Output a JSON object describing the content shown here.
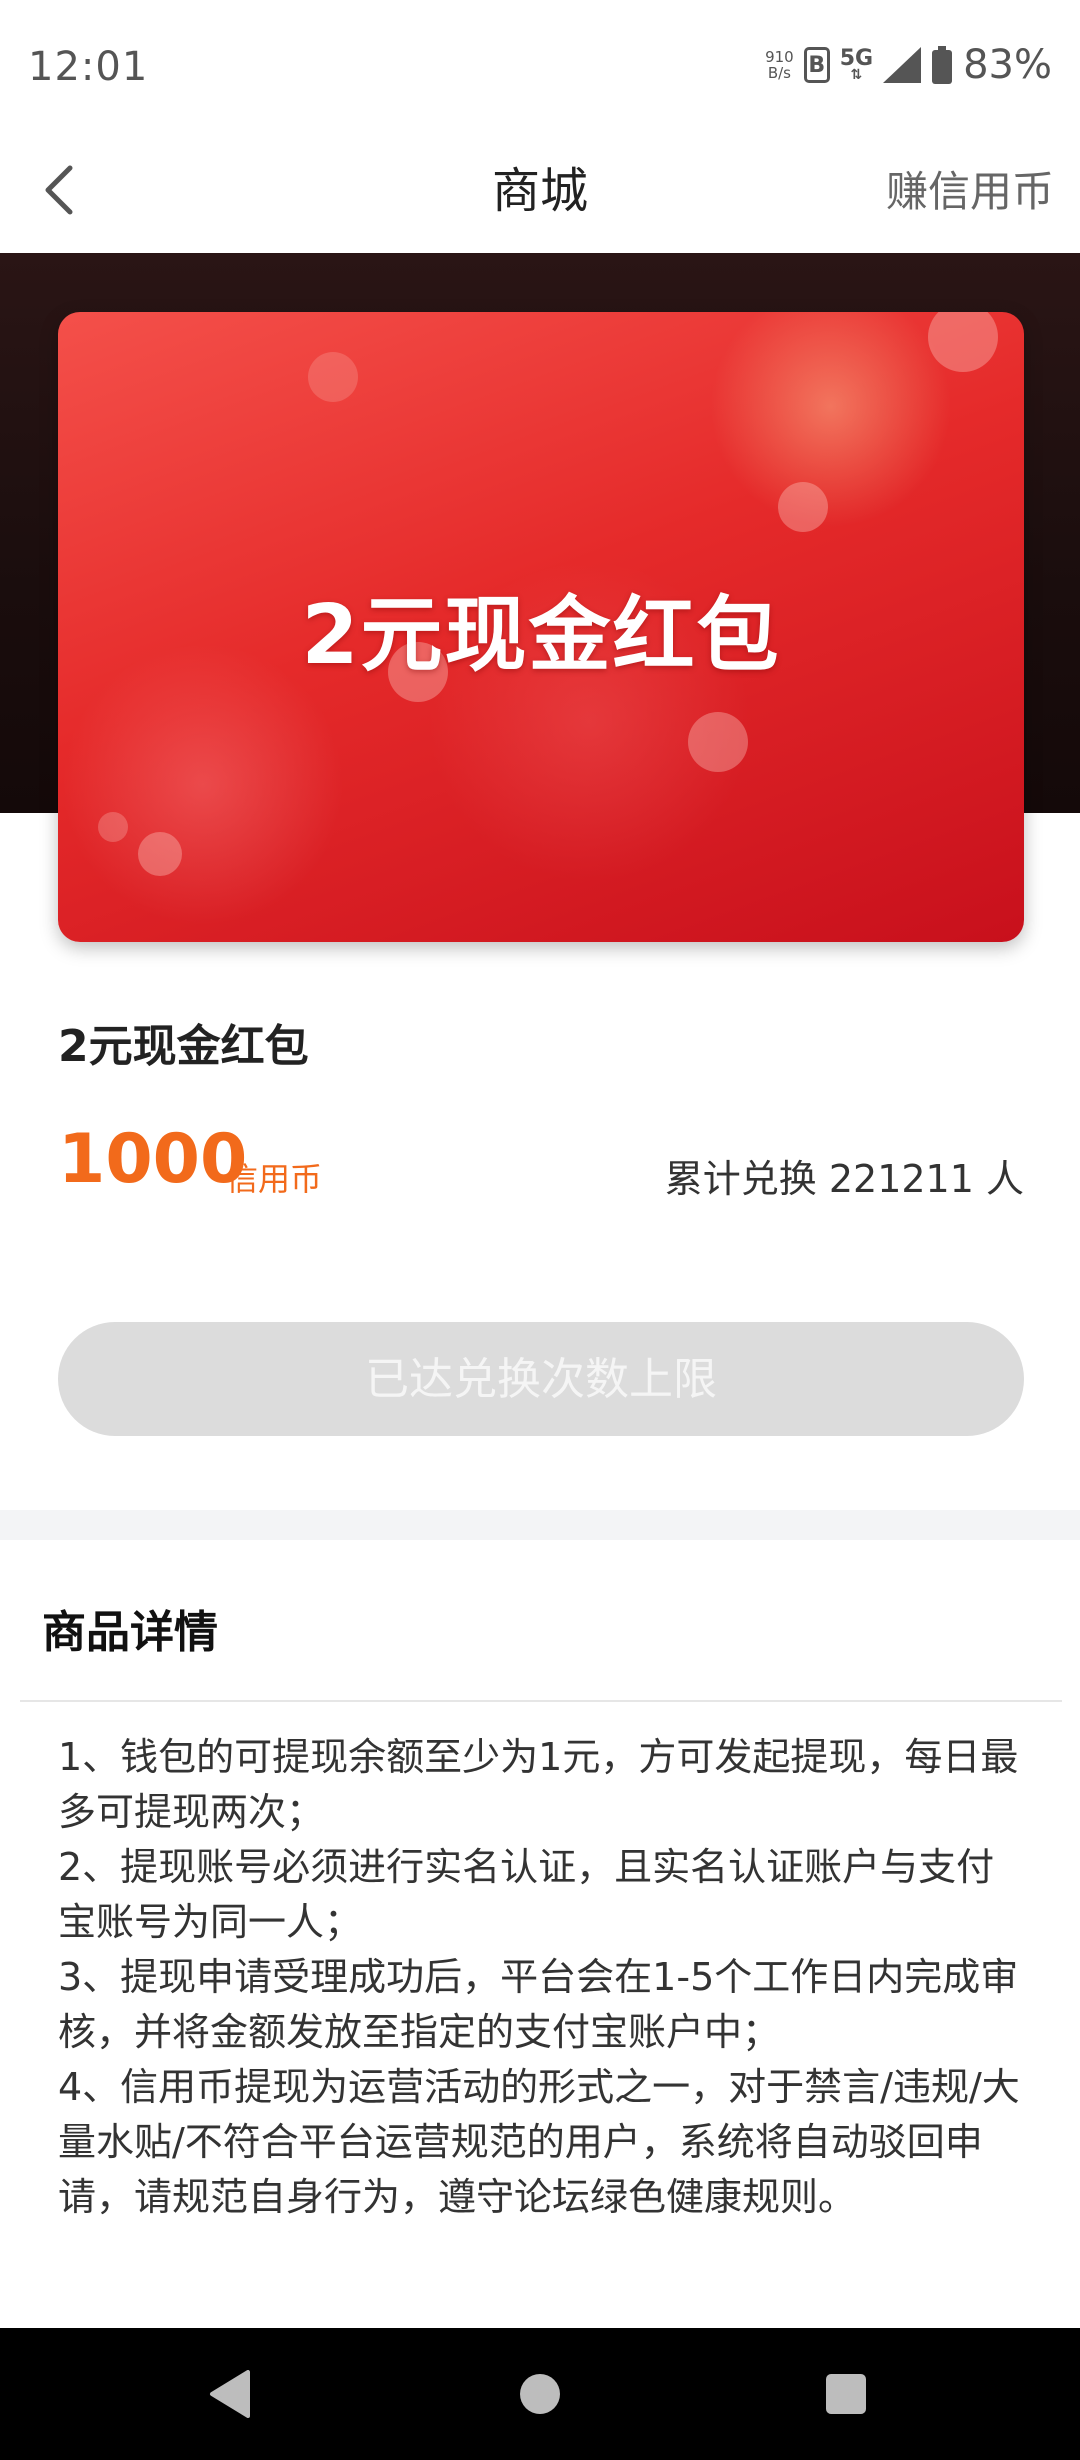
{
  "status_bar": {
    "time": "12:01",
    "net_speed_value": "910",
    "net_speed_unit": "B/s",
    "b_badge": "B",
    "network": "5G",
    "battery": "83%"
  },
  "nav": {
    "title": "商城",
    "right_link": "赚信用币"
  },
  "hero": {
    "card_title": "2元现金红包"
  },
  "product": {
    "name": "2元现金红包",
    "price": "1000",
    "price_unit": "信用币",
    "exchange_count": "累计兑换 221211 人"
  },
  "redeem_button": {
    "label": "已达兑换次数上限"
  },
  "details": {
    "title": "商品详情",
    "items": [
      "1、钱包的可提现余额至少为1元，方可发起提现，每日最多可提现两次；",
      "2、提现账号必须进行实名认证，且实名认证账户与支付宝账号为同一人；",
      "3、提现申请受理成功后，平台会在1-5个工作日内完成审核，并将金额发放至指定的支付宝账户中；",
      "4、信用币提现为运营活动的形式之一，对于禁言/违规/大量水贴/不符合平台运营规范的用户，系统将自动驳回申请，请规范自身行为，遵守论坛绿色健康规则。"
    ]
  },
  "colors": {
    "accent_orange": "#f26a1b",
    "hero_red": "#e52a2a",
    "disabled_button": "#dcdcdc"
  },
  "icons": {
    "back": "chevron-left-icon",
    "sys_back": "triangle-back-icon",
    "sys_home": "circle-home-icon",
    "sys_recents": "square-recents-icon"
  }
}
